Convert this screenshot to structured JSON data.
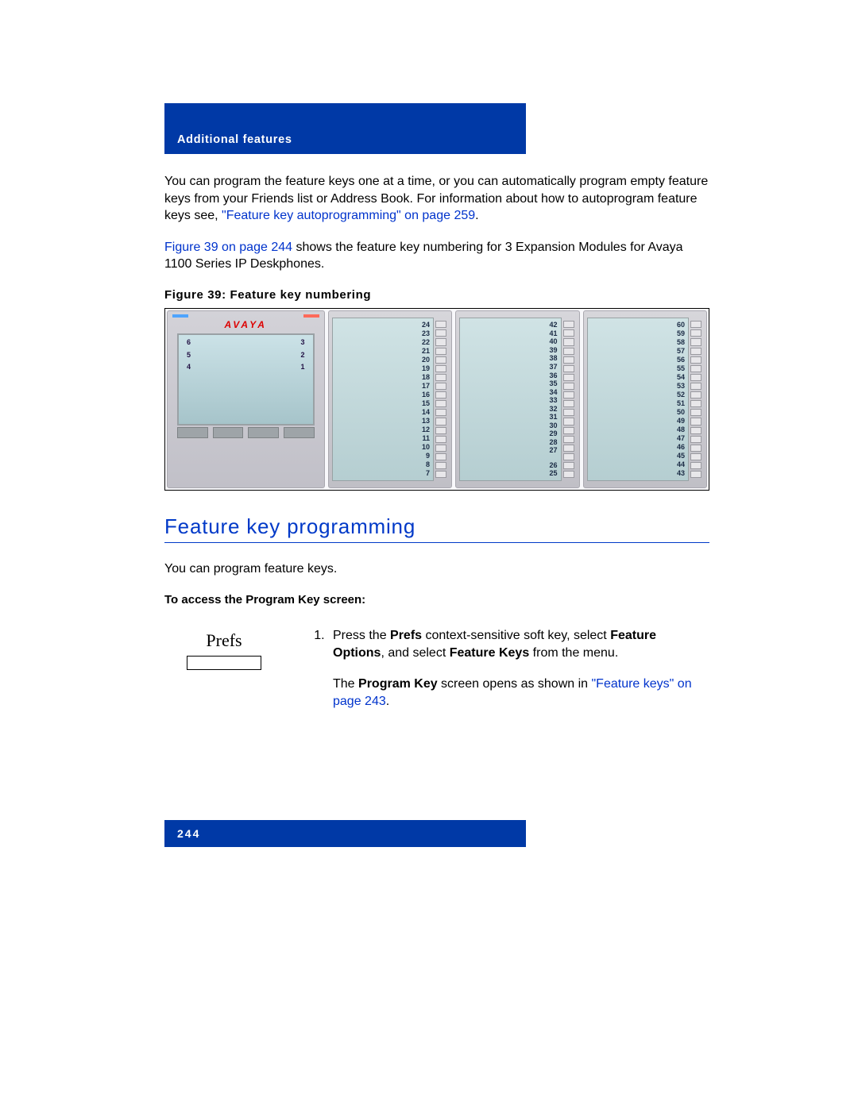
{
  "header": {
    "section": "Additional features"
  },
  "intro": {
    "p1a": "You can program the feature keys one at a time, or you can automatically program empty feature keys from your Friends list or Address Book. For information about how to autoprogram feature keys see, ",
    "p1_link": "\"Feature key autoprogramming\" on page 259",
    "p1b": ".",
    "p2_link": "Figure 39 on page 244",
    "p2a": " shows the feature key numbering for 3 Expansion Modules for Avaya 1100 Series IP Deskphones."
  },
  "figure": {
    "caption": "Figure 39: Feature key numbering",
    "brand": "AVAYA",
    "phone_left": [
      "6",
      "5",
      "4"
    ],
    "phone_right": [
      "3",
      "2",
      "1"
    ],
    "module1_top": [
      "24",
      "23",
      "22",
      "21",
      "20",
      "19",
      "18",
      "17",
      "16",
      "15",
      "14",
      "13",
      "12",
      "11",
      "10",
      "9",
      "8",
      "7"
    ],
    "module2_top": [
      "42",
      "41",
      "40",
      "39",
      "38",
      "37",
      "36",
      "35",
      "34",
      "33",
      "32",
      "31",
      "30",
      "29",
      "28",
      "27"
    ],
    "module2_bottom": [
      "26",
      "25"
    ],
    "module3_top": [
      "60",
      "59",
      "58",
      "57",
      "56",
      "55",
      "54",
      "53",
      "52",
      "51",
      "50",
      "49",
      "48",
      "47",
      "46",
      "45",
      "44",
      "43"
    ]
  },
  "section": {
    "title": "Feature key programming",
    "lead": "You can program feature keys.",
    "subhead": "To access the Program Key screen:",
    "prefs_label": "Prefs",
    "step1_a": "Press the ",
    "step1_prefs": "Prefs",
    "step1_b": " context-sensitive soft key, select ",
    "step1_featopt": "Feature Options",
    "step1_c": ", and select ",
    "step1_featkeys": "Feature Keys",
    "step1_d": " from the menu.",
    "step2_a": "The ",
    "step2_progkey": "Program Key",
    "step2_b": " screen opens as shown in ",
    "step2_link": "\"Feature keys\" on page 243",
    "step2_c": "."
  },
  "footer": {
    "page": "244"
  }
}
